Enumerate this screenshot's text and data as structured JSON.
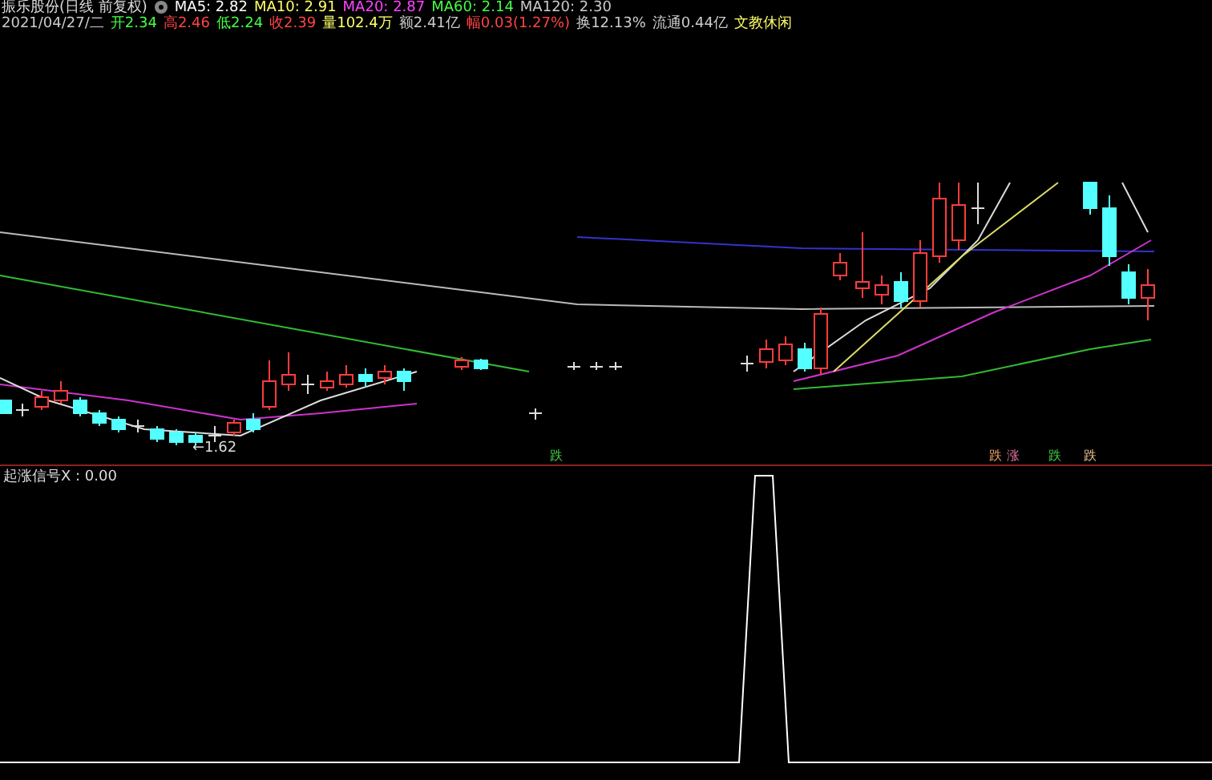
{
  "title": {
    "name": "振乐股份(日线 前复权)",
    "averages": [
      {
        "label": "MA5: 2.82",
        "color": "#ffffff"
      },
      {
        "label": "MA10: 2.91",
        "color": "#ffff66"
      },
      {
        "label": "MA20: 2.87",
        "color": "#ff44ff"
      },
      {
        "label": "MA60: 2.14",
        "color": "#44ff44"
      },
      {
        "label": "MA120: 2.30",
        "color": "#cccccc"
      }
    ]
  },
  "quote": [
    {
      "text": "2021/04/27/二",
      "color": "#cccccc"
    },
    {
      "text": "开2.34",
      "color": "#44ff44"
    },
    {
      "text": "高2.46",
      "color": "#ff4444"
    },
    {
      "text": "低2.24",
      "color": "#44ff44"
    },
    {
      "text": "收2.39",
      "color": "#ff4444"
    },
    {
      "text": "量102.4万",
      "color": "#ffff66"
    },
    {
      "text": "额2.41亿",
      "color": "#cccccc"
    },
    {
      "text": "幅0.03(1.27%)",
      "color": "#ff4444"
    },
    {
      "text": "换12.13%",
      "color": "#cccccc"
    },
    {
      "text": "流通0.44亿",
      "color": "#cccccc"
    },
    {
      "text": "文教休闲",
      "color": "#ffff66"
    }
  ],
  "low_label": "←1.62",
  "markers": [
    {
      "text": "跌",
      "color": "#44cc44"
    },
    {
      "text": "跌",
      "color": "#e8a060"
    },
    {
      "text": "涨",
      "color": "#e070a0"
    },
    {
      "text": "跌",
      "color": "#44cc44"
    },
    {
      "text": "跌",
      "color": "#e8c090"
    }
  ],
  "indicator": {
    "label": "起涨信号X : 0.00"
  }
}
